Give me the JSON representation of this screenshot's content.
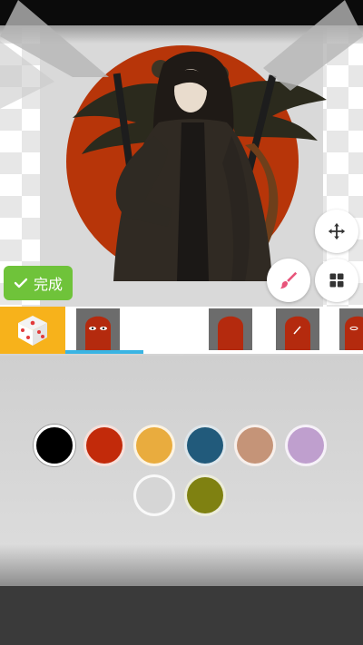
{
  "buttons": {
    "done_label": "完成"
  },
  "icons": {
    "move": "move-arrows-icon",
    "brush": "brush-icon",
    "grid": "grid-icon",
    "check": "check-icon",
    "dice": "dice-icon"
  },
  "palette": {
    "colors": [
      "#000000",
      "#c22a0a",
      "#e9ac3e",
      "#215a7b",
      "#c59478",
      "#bf9fce",
      "#d6d6d6",
      "#7f8111"
    ],
    "selected_index": 0
  },
  "theme": {
    "accent": "#39b4e3",
    "done_green": "#6fc33a",
    "dice_yellow": "#f7b21b",
    "brush_pink": "#e8547a"
  }
}
